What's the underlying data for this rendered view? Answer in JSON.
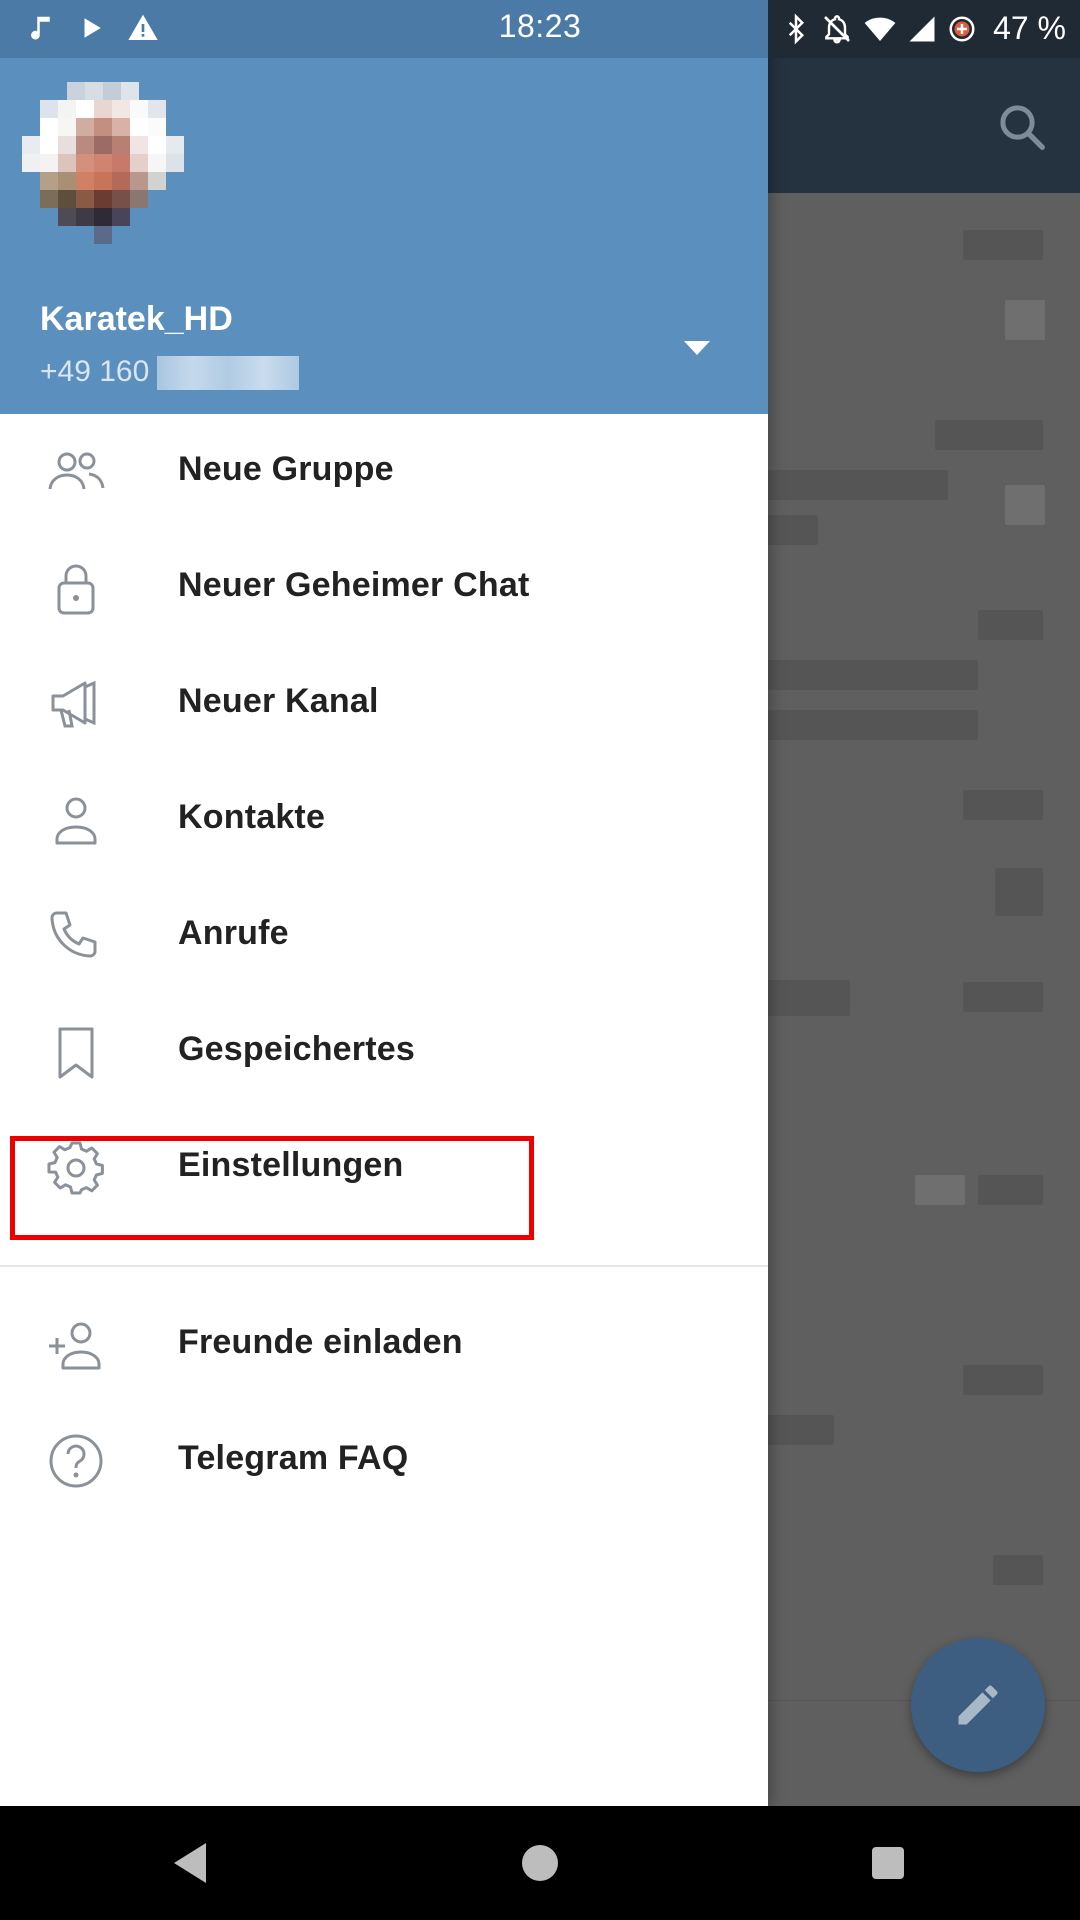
{
  "status_bar": {
    "time": "18:23",
    "battery": "47 %",
    "left_icons": [
      "music-note-icon",
      "play-icon",
      "warning-icon"
    ],
    "right_icons": [
      "bluetooth-icon",
      "notifications-off-icon",
      "wifi-icon",
      "signal-icon",
      "data-saver-icon"
    ]
  },
  "profile": {
    "name": "Karatek_HD",
    "phone_visible": "+49 160"
  },
  "menu": {
    "items": [
      {
        "label": "Neue Gruppe",
        "icon": "group-icon"
      },
      {
        "label": "Neuer Geheimer Chat",
        "icon": "lock-icon"
      },
      {
        "label": "Neuer Kanal",
        "icon": "megaphone-icon"
      },
      {
        "label": "Kontakte",
        "icon": "person-icon"
      },
      {
        "label": "Anrufe",
        "icon": "phone-icon"
      },
      {
        "label": "Gespeichertes",
        "icon": "bookmark-icon"
      },
      {
        "label": "Einstellungen",
        "icon": "gear-icon"
      }
    ],
    "secondary_items": [
      {
        "label": "Freunde einladen",
        "icon": "add-person-icon"
      },
      {
        "label": "Telegram FAQ",
        "icon": "help-icon"
      }
    ]
  },
  "highlight": {
    "target": "Einstellungen",
    "color": "#ee0000"
  },
  "colors": {
    "header": "#5a8fbe",
    "toolbar": "#25323f",
    "fab": "#3d5e80"
  }
}
